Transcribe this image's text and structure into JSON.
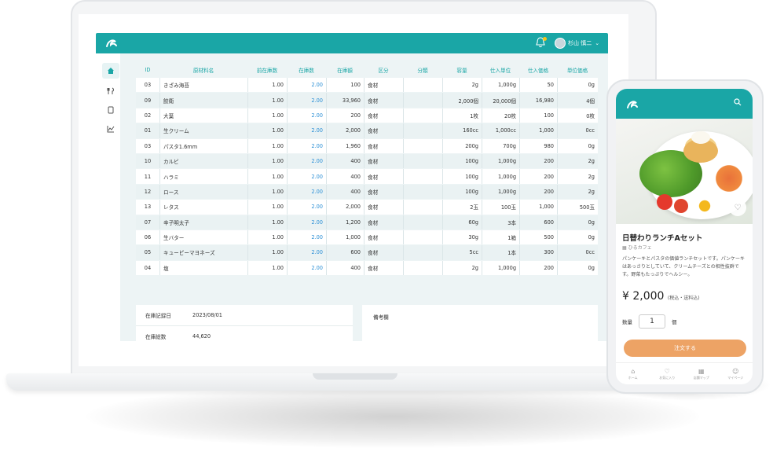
{
  "admin": {
    "user_name": "杉山 慎二",
    "user_chevron": "⌄",
    "icons": {
      "logo": "wave-logo",
      "bell": "bell-icon",
      "home": "home-icon",
      "utensils": "fork-knife-icon",
      "tablet": "tablet-icon",
      "chart": "chart-icon"
    },
    "columns": [
      "ID",
      "原材料名",
      "前在庫数",
      "在庫数",
      "在庫額",
      "区分",
      "分類",
      "容量",
      "仕入単位",
      "仕入価格",
      "単位価格"
    ],
    "rows": [
      {
        "id": "03",
        "name": "きざみ海苔",
        "prev": "1.00",
        "stock": "2.00",
        "amount": "100",
        "kubun": "食材",
        "bunrui": "",
        "yoryo": "2g",
        "unit": "1,000g",
        "price": "50",
        "uprice": "0g"
      },
      {
        "id": "09",
        "name": "餃衛",
        "prev": "1.00",
        "stock": "2.00",
        "amount": "33,960",
        "kubun": "食材",
        "bunrui": "",
        "yoryo": "2,000個",
        "unit": "20,000個",
        "price": "16,980",
        "uprice": "4個"
      },
      {
        "id": "02",
        "name": "大葉",
        "prev": "1.00",
        "stock": "2.00",
        "amount": "200",
        "kubun": "食材",
        "bunrui": "",
        "yoryo": "1枚",
        "unit": "20枚",
        "price": "100",
        "uprice": "0枚"
      },
      {
        "id": "01",
        "name": "生クリーム",
        "prev": "1.00",
        "stock": "2.00",
        "amount": "2,000",
        "kubun": "食材",
        "bunrui": "",
        "yoryo": "160cc",
        "unit": "1,000cc",
        "price": "1,000",
        "uprice": "0cc"
      },
      {
        "id": "03",
        "name": "パスタ1.6mm",
        "prev": "1.00",
        "stock": "2.00",
        "amount": "1,960",
        "kubun": "食材",
        "bunrui": "",
        "yoryo": "200g",
        "unit": "700g",
        "price": "980",
        "uprice": "0g"
      },
      {
        "id": "10",
        "name": "カルビ",
        "prev": "1.00",
        "stock": "2.00",
        "amount": "400",
        "kubun": "食材",
        "bunrui": "",
        "yoryo": "100g",
        "unit": "1,000g",
        "price": "200",
        "uprice": "2g"
      },
      {
        "id": "11",
        "name": "ハラミ",
        "prev": "1.00",
        "stock": "2.00",
        "amount": "400",
        "kubun": "食材",
        "bunrui": "",
        "yoryo": "100g",
        "unit": "1,000g",
        "price": "200",
        "uprice": "2g"
      },
      {
        "id": "12",
        "name": "ロース",
        "prev": "1.00",
        "stock": "2.00",
        "amount": "400",
        "kubun": "食材",
        "bunrui": "",
        "yoryo": "100g",
        "unit": "1,000g",
        "price": "200",
        "uprice": "2g"
      },
      {
        "id": "13",
        "name": "レタス",
        "prev": "1.00",
        "stock": "2.00",
        "amount": "2,000",
        "kubun": "食材",
        "bunrui": "",
        "yoryo": "2玉",
        "unit": "100玉",
        "price": "1,000",
        "uprice": "500玉"
      },
      {
        "id": "07",
        "name": "辛子明太子",
        "prev": "1.00",
        "stock": "2.00",
        "amount": "1,200",
        "kubun": "食材",
        "bunrui": "",
        "yoryo": "60g",
        "unit": "3本",
        "price": "600",
        "uprice": "0g"
      },
      {
        "id": "06",
        "name": "生バター",
        "prev": "1.00",
        "stock": "2.00",
        "amount": "1,000",
        "kubun": "食材",
        "bunrui": "",
        "yoryo": "30g",
        "unit": "1箱",
        "price": "500",
        "uprice": "0g"
      },
      {
        "id": "05",
        "name": "キューピーマヨネーズ",
        "prev": "1.00",
        "stock": "2.00",
        "amount": "600",
        "kubun": "食材",
        "bunrui": "",
        "yoryo": "5cc",
        "unit": "1本",
        "price": "300",
        "uprice": "0cc"
      },
      {
        "id": "04",
        "name": "塩",
        "prev": "1.00",
        "stock": "2.00",
        "amount": "400",
        "kubun": "食材",
        "bunrui": "",
        "yoryo": "2g",
        "unit": "1,000g",
        "price": "200",
        "uprice": "0g"
      }
    ],
    "summary": {
      "date_label": "在庫記録日",
      "date_value": "2023/08/01",
      "total_label": "在庫総数",
      "total_value": "44,620"
    },
    "memo_label": "備考欄"
  },
  "phone": {
    "icons": {
      "logo": "wave-logo",
      "search": "search-icon",
      "heart": "heart-icon"
    },
    "title": "日替わりランチAセット",
    "shop": "ひるカフェ",
    "description": "パンケーキとパスタの価値ランチセットです。パンケーキはあっさりとしていて、クリームチーズとの相性抜群です。野菜もたっぷりでヘルシー。",
    "price": "¥ 2,000",
    "price_note": "(税込・送料込)",
    "qty_label": "数量",
    "qty_value": "1",
    "qty_unit": "個",
    "order_button": "注文する",
    "tabs": [
      {
        "icon": "home-icon",
        "label": "ホーム"
      },
      {
        "icon": "heart-icon",
        "label": "お気に入り"
      },
      {
        "icon": "shop-icon",
        "label": "店舗マップ"
      },
      {
        "icon": "user-icon",
        "label": "マイページ"
      }
    ]
  }
}
